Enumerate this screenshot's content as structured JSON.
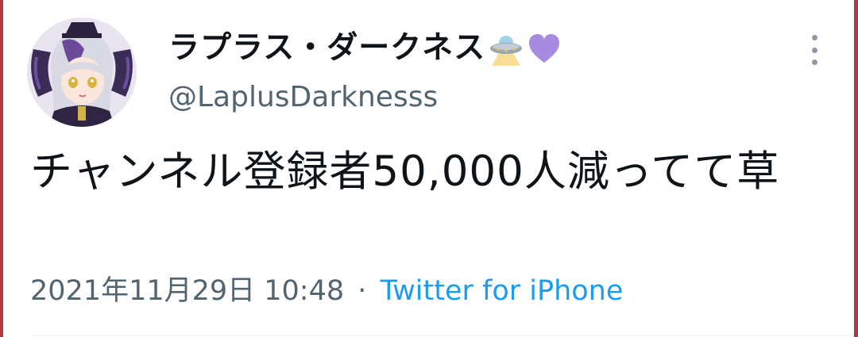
{
  "tweet": {
    "display_name": "ラプラス・ダークネス",
    "name_emojis": [
      "ufo-icon",
      "purple-heart-icon"
    ],
    "handle": "@LaplusDarknesss",
    "text": "チャンネル登録者50,000人減ってて草",
    "timestamp": "2021年11月29日 10:48",
    "separator": "·",
    "source": "Twitter for iPhone"
  },
  "colors": {
    "text": "#0f1419",
    "secondary": "#536471",
    "link": "#1d9bf0",
    "heart": "#a88be0",
    "frame": "#b3383c"
  }
}
